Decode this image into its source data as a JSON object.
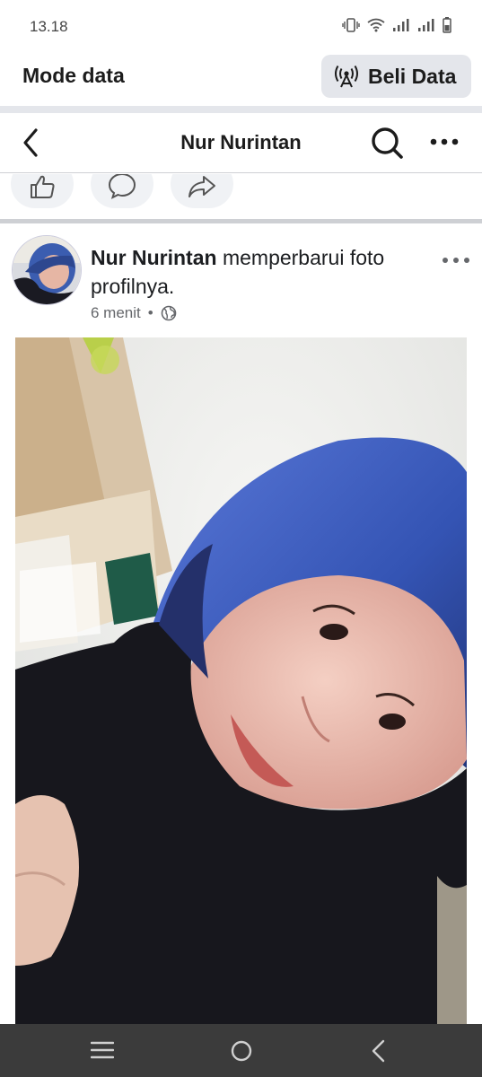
{
  "status_bar": {
    "time": "13.18",
    "icons": [
      "vibrate-icon",
      "wifi-icon",
      "signal-icon",
      "signal-icon",
      "battery-icon"
    ]
  },
  "data_bar": {
    "title": "Mode data",
    "button_label": "Beli Data",
    "button_icon": "antenna-icon"
  },
  "navbar": {
    "title": "Nur Nurintan",
    "icons": [
      "back-icon",
      "search-icon",
      "more-icon"
    ]
  },
  "actions": {
    "icons": [
      "like-icon",
      "comment-icon",
      "share-icon"
    ]
  },
  "post": {
    "author": "Nur Nurintan",
    "action_text": " memperbarui foto profilnya.",
    "time": "6 menit",
    "separator": "•",
    "privacy_icon": "globe-icon"
  },
  "colors": {
    "accent_bg": "#e4e6eb",
    "text": "#1c1e21",
    "muted": "#65676b",
    "bottom_nav": "#3b3b3b"
  }
}
